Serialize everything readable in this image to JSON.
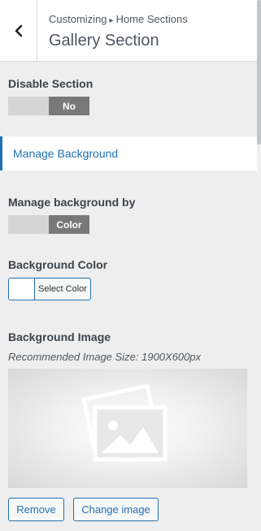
{
  "header": {
    "breadcrumb_parent": "Customizing",
    "breadcrumb_separator": "▸",
    "breadcrumb_current": "Home Sections",
    "title": "Gallery Section",
    "back_icon": "chevron-left-icon"
  },
  "disable_section": {
    "label": "Disable Section",
    "toggle_value": "No"
  },
  "manage_background_section": {
    "label": "Manage Background",
    "accent_color": "#2271b1"
  },
  "manage_background_by": {
    "label": "Manage background by",
    "toggle_value": "Color"
  },
  "background_color": {
    "label": "Background Color",
    "button_label": "Select Color",
    "current_color": "#ffffff"
  },
  "background_image": {
    "label": "Background Image",
    "hint": "Recommended Image Size: 1900X600px",
    "placeholder_icon": "image-placeholder-icon",
    "remove_label": "Remove",
    "change_label": "Change image"
  }
}
